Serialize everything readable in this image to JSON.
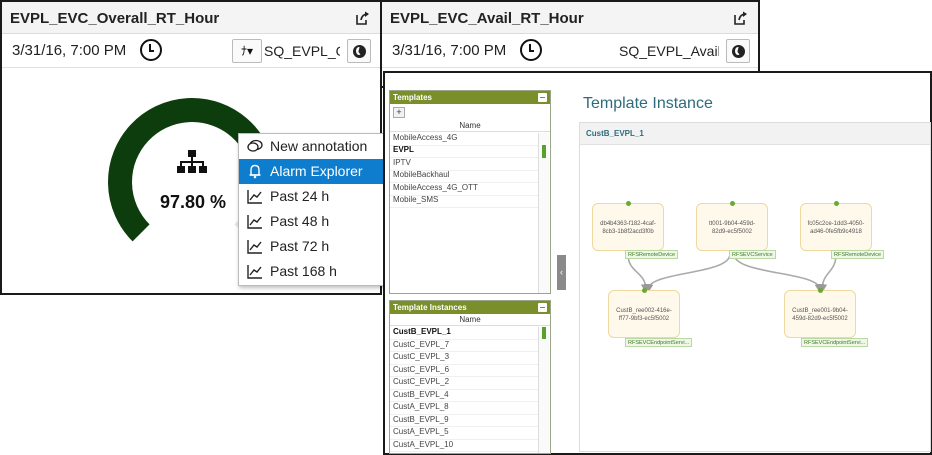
{
  "left_panel": {
    "title": "EVPL_EVC_Overall_RT_Hour",
    "datetime": "3/31/16, 7:00 PM",
    "selection": "SQ_EVPL_Ov",
    "gauge_value": "97.80 %",
    "gauge_fraction": 0.978
  },
  "right_panel": {
    "title": "EVPL_EVC_Avail_RT_Hour",
    "datetime": "3/31/16, 7:00 PM",
    "selection": "SQ_EVPL_Availa"
  },
  "context_menu": {
    "items": [
      {
        "label": "New annotation",
        "icon": "speech-bubble-icon"
      },
      {
        "label": "Alarm Explorer",
        "icon": "bell-icon",
        "active": true
      },
      {
        "label": "Past 24 h",
        "icon": "trend-chart-icon"
      },
      {
        "label": "Past 48 h",
        "icon": "trend-chart-icon"
      },
      {
        "label": "Past 72 h",
        "icon": "trend-chart-icon"
      },
      {
        "label": "Past 168 h",
        "icon": "trend-chart-icon"
      }
    ]
  },
  "templates": {
    "header": "Templates",
    "column": "Name",
    "items": [
      "MobileAccess_4G",
      "EVPL",
      "IPTV",
      "MobileBackhaul",
      "MobileAccess_4G_OTT",
      "Mobile_SMS"
    ],
    "selected": "EVPL"
  },
  "template_instances": {
    "header": "Template Instances",
    "column": "Name",
    "items": [
      "CustB_EVPL_1",
      "CustC_EVPL_7",
      "CustC_EVPL_3",
      "CustC_EVPL_6",
      "CustC_EVPL_2",
      "CustB_EVPL_4",
      "CustA_EVPL_8",
      "CustB_EVPL_9",
      "CustA_EVPL_5",
      "CustA_EVPL_10"
    ],
    "selected": "CustB_EVPL_1"
  },
  "instance_view": {
    "title": "Template Instance",
    "canvas_title": "CustB_EVPL_1",
    "nodes": [
      {
        "id": "db4b4363-f182-4caf-8cb3-1b8f2acd3f0b",
        "line1": "db4b4363-f182-4caf-",
        "line2": "8cb3-1b8f2acd3f0b",
        "tag": "RFSRemoteDevice"
      },
      {
        "id": "tt001-9b04-459d-82d9-ec5f5002",
        "line1": "tt001-9b04-459d-",
        "line2": "82d9-ec5f5002",
        "tag": "RFSEVCService"
      },
      {
        "id": "fc05c2ce-1dd3-4050-ad46-0fe5fb9c4918",
        "line1": "fc05c2ce-1dd3-4050-",
        "line2": "ad46-0fe5fb9c4918",
        "tag": "RFSRemoteDevice"
      },
      {
        "id": "CustB_ree002-416e-ff77-9bf3-ec5f5002",
        "line1": "CustB_ree002-416e-",
        "line2": "ff77-9bf3-ec5f5002",
        "tag": "RFSEVCEndpointServi..."
      },
      {
        "id": "CustB_ree001-9b04-459d-82d9-ec5f5002",
        "line1": "CustB_ree001-9b04-",
        "line2": "459d-82d9-ec5f5002",
        "tag": "RFSEVCEndpointServi..."
      }
    ]
  },
  "colors": {
    "gauge": "#0d3c0d",
    "gauge_track": "#e6e6e6",
    "menu_active": "#0f7dcd",
    "section_header": "#7a8f2a",
    "title_teal": "#2e6b7d"
  }
}
